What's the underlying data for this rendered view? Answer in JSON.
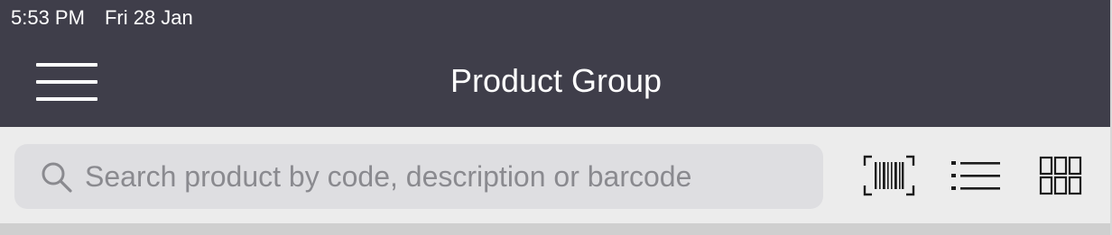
{
  "status_bar": {
    "time": "5:53 PM",
    "date": "Fri 28 Jan"
  },
  "header": {
    "title": "Product Group",
    "menu_icon": "hamburger-menu-icon"
  },
  "search": {
    "placeholder": "Search product by code, description or barcode",
    "value": "",
    "icon": "search-icon"
  },
  "toolbar": {
    "icons": [
      "barcode-scan-icon",
      "list-view-icon",
      "grid-view-icon"
    ]
  },
  "colors": {
    "header_bg": "#3f3e4a",
    "page_bg": "#ececec",
    "search_bg": "#dedee1",
    "icon_color": "#1c1c1c",
    "header_text": "#ffffff"
  }
}
